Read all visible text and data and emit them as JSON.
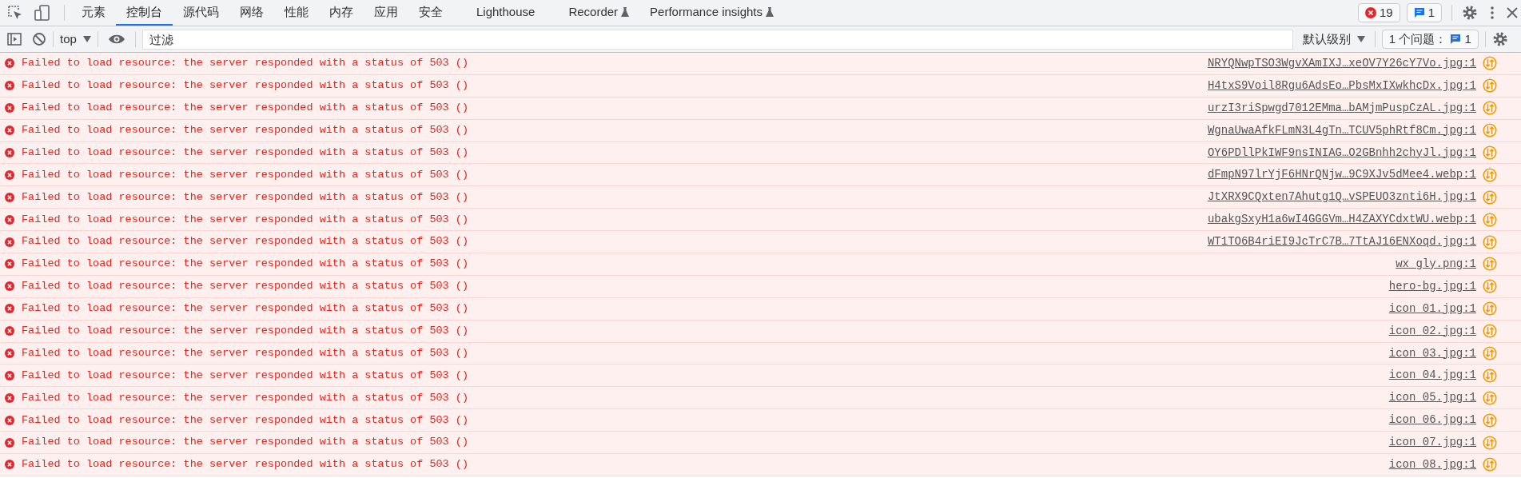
{
  "tabs": [
    {
      "label": "元素",
      "selected": false,
      "experimental": false
    },
    {
      "label": "控制台",
      "selected": true,
      "experimental": false
    },
    {
      "label": "源代码",
      "selected": false,
      "experimental": false
    },
    {
      "label": "网络",
      "selected": false,
      "experimental": false
    },
    {
      "label": "性能",
      "selected": false,
      "experimental": false
    },
    {
      "label": "内存",
      "selected": false,
      "experimental": false
    },
    {
      "label": "应用",
      "selected": false,
      "experimental": false
    },
    {
      "label": "安全",
      "selected": false,
      "experimental": false
    },
    {
      "label": "Lighthouse",
      "selected": false,
      "experimental": false
    },
    {
      "label": "Recorder",
      "selected": false,
      "experimental": true
    },
    {
      "label": "Performance insights",
      "selected": false,
      "experimental": true
    }
  ],
  "error_count": "19",
  "issue_count": "1",
  "toolbar": {
    "context": "top",
    "filter": {
      "placeholder": "过滤"
    },
    "level": "默认级别",
    "issues_label": "1 个问题：",
    "issues_count": "1"
  },
  "messages": [
    {
      "text": "Failed to load resource: the server responded with a status of 503 ()",
      "source": "NRYQNwpTSO3WgvXAmIXJ…xeOV7Y26cY7Vo.jpg:1"
    },
    {
      "text": "Failed to load resource: the server responded with a status of 503 ()",
      "source": "H4txS9Voil8Rgu6AdsEo…PbsMxIXwkhcDx.jpg:1"
    },
    {
      "text": "Failed to load resource: the server responded with a status of 503 ()",
      "source": "urzI3riSpwgd7012EMma…bAMjmPuspCzAL.jpg:1"
    },
    {
      "text": "Failed to load resource: the server responded with a status of 503 ()",
      "source": "WgnaUwaAfkFLmN3L4gTn…TCUV5phRtf8Cm.jpg:1"
    },
    {
      "text": "Failed to load resource: the server responded with a status of 503 ()",
      "source": "OY6PDllPkIWF9nsINIAG…O2GBnhh2chyJl.jpg:1"
    },
    {
      "text": "Failed to load resource: the server responded with a status of 503 ()",
      "source": "dFmpN97lrYjF6HNrQNjw…9C9XJv5dMee4.webp:1"
    },
    {
      "text": "Failed to load resource: the server responded with a status of 503 ()",
      "source": "JtXRX9CQxten7Ahutg1Q…vSPEUO3znti6H.jpg:1"
    },
    {
      "text": "Failed to load resource: the server responded with a status of 503 ()",
      "source": "ubakgSxyH1a6wI4GGGVm…H4ZAXYCdxtWU.webp:1"
    },
    {
      "text": "Failed to load resource: the server responded with a status of 503 ()",
      "source": "WT1TO6B4riEI9JcTrC7B…7TtAJ16ENXoqd.jpg:1"
    },
    {
      "text": "Failed to load resource: the server responded with a status of 503 ()",
      "source": "wx_gly.png:1"
    },
    {
      "text": "Failed to load resource: the server responded with a status of 503 ()",
      "source": "hero-bg.jpg:1"
    },
    {
      "text": "Failed to load resource: the server responded with a status of 503 ()",
      "source": "icon_01.jpg:1"
    },
    {
      "text": "Failed to load resource: the server responded with a status of 503 ()",
      "source": "icon_02.jpg:1"
    },
    {
      "text": "Failed to load resource: the server responded with a status of 503 ()",
      "source": "icon_03.jpg:1"
    },
    {
      "text": "Failed to load resource: the server responded with a status of 503 ()",
      "source": "icon_04.jpg:1"
    },
    {
      "text": "Failed to load resource: the server responded with a status of 503 ()",
      "source": "icon_05.jpg:1"
    },
    {
      "text": "Failed to load resource: the server responded with a status of 503 ()",
      "source": "icon_06.jpg:1"
    },
    {
      "text": "Failed to load resource: the server responded with a status of 503 ()",
      "source": "icon_07.jpg:1"
    },
    {
      "text": "Failed to load resource: the server responded with a status of 503 ()",
      "source": "icon_08.jpg:1"
    }
  ]
}
